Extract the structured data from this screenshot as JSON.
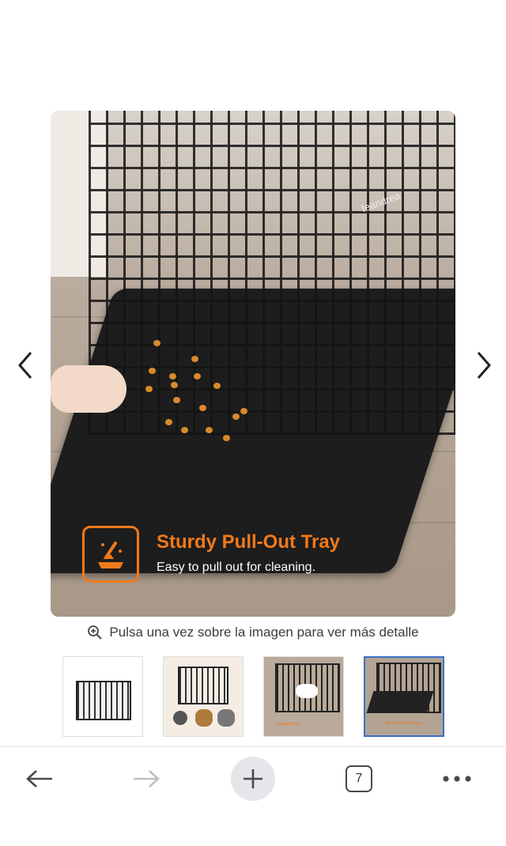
{
  "product_image": {
    "brand_on_crate": "feandrea",
    "feature_title": "Sturdy Pull-Out Tray",
    "feature_subtitle": "Easy to pull out for cleaning.",
    "accent_color": "#f07a1a"
  },
  "nav": {
    "prev_icon": "chevron-left-icon",
    "next_icon": "chevron-right-icon"
  },
  "hint": {
    "icon": "zoom-in-icon",
    "text": "Pulsa una vez sobre la imagen para ver más detalle"
  },
  "thumbnails": {
    "items": [
      {
        "caption": ""
      },
      {
        "caption": ""
      },
      {
        "caption": "Durable Wire"
      },
      {
        "caption": "Sturdy Pull-Out Tray"
      }
    ],
    "active_index": 3
  },
  "browser_toolbar": {
    "back_icon": "arrow-left-icon",
    "forward_icon": "arrow-right-icon",
    "new_tab_icon": "plus-icon",
    "tab_count": "7",
    "menu_icon": "more-dots-icon"
  }
}
